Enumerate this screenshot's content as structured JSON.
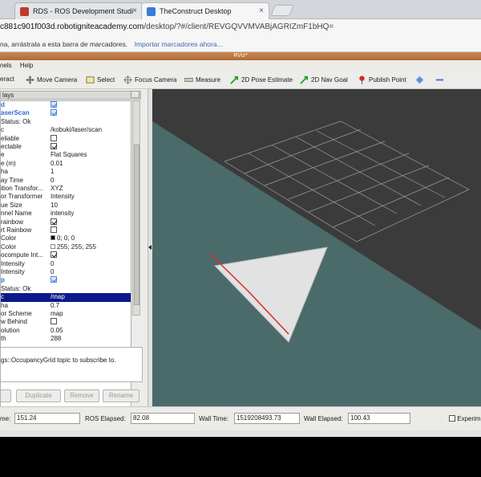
{
  "browser": {
    "tabs": [
      {
        "label": "RDS - ROS Development Studi",
        "active": false,
        "favicon_color": "#c0392b"
      },
      {
        "label": "TheConstruct Desktop",
        "active": true,
        "favicon_color": "#3a7bd5"
      }
    ],
    "url_host": "c881c901f003d.robotigniteacademy.com",
    "url_path": "/desktop/?#/client/REVGQVVMVABjAGRIZmF1bHQ=",
    "bookmarks_hint": "na, arrástrala a esta barra de marcadores.",
    "bookmarks_link": "Importar marcadores ahora..."
  },
  "rviz": {
    "title": "RViz*",
    "menu": [
      "nels",
      "Help"
    ],
    "toolbar": [
      "eract",
      "Move Camera",
      "Select",
      "Focus Camera",
      "Measure",
      "2D Pose Estimate",
      "2D Nav Goal",
      "Publish Point"
    ],
    "panel_title": "lays",
    "tree": [
      {
        "k": "d",
        "v": "",
        "cb": "blue-on",
        "style": "blue"
      },
      {
        "k": "aserScan",
        "v": "",
        "cb": "blue-on",
        "style": "blue"
      },
      {
        "k": "Status: Ok",
        "v": ""
      },
      {
        "k": "c",
        "v": "/kobuki/laser/scan"
      },
      {
        "k": "eliable",
        "v": "",
        "cb": "off"
      },
      {
        "k": "ectable",
        "v": "",
        "cb": "on"
      },
      {
        "k": "e",
        "v": "Flat Squares"
      },
      {
        "k": "e (m)",
        "v": "0.01"
      },
      {
        "k": "ha",
        "v": "1"
      },
      {
        "k": "ay Time",
        "v": "0"
      },
      {
        "k": "ition Transfor...",
        "v": "XYZ"
      },
      {
        "k": "or Transformer",
        "v": "Intensity"
      },
      {
        "k": "ue Size",
        "v": "10"
      },
      {
        "k": "nnel Name",
        "v": "intensity"
      },
      {
        "k": "rainbow",
        "v": "",
        "cb": "on"
      },
      {
        "k": "rt Rainbow",
        "v": "",
        "cb": "off"
      },
      {
        "k": "Color",
        "v": "0; 0; 0",
        "swatch": "#000000"
      },
      {
        "k": "Color",
        "v": "255; 255; 255",
        "swatch": "#ffffff"
      },
      {
        "k": "ocompute Int...",
        "v": "",
        "cb": "on"
      },
      {
        "k": "Intensity",
        "v": "0"
      },
      {
        "k": "Intensity",
        "v": "0"
      },
      {
        "k": "p",
        "v": "",
        "cb": "blue-on",
        "style": "blue"
      },
      {
        "k": "Status: Ok",
        "v": ""
      },
      {
        "k": "c",
        "v": "/map",
        "style": "hl"
      },
      {
        "k": "ha",
        "v": "0.7"
      },
      {
        "k": "or Scheme",
        "v": "map"
      },
      {
        "k": "w Behind",
        "v": "",
        "cb": "off"
      },
      {
        "k": "olution",
        "v": "0.05"
      },
      {
        "k": "th",
        "v": "288"
      }
    ],
    "description": "gs::OccupancyGrid topic to subscribe to.",
    "buttons": [
      "Duplicate",
      "Remove",
      "Rename"
    ],
    "time": {
      "ros_time_label": "me:",
      "ros_time": "151.24",
      "ros_elapsed_label": "ROS Elapsed:",
      "ros_elapsed": "82.08",
      "wall_time_label": "Wall Time:",
      "wall_time": "1519208493.73",
      "wall_elapsed_label": "Wall Elapsed:",
      "wall_elapsed": "100.43",
      "experimental_label": "Experim"
    }
  },
  "colors": {
    "grid_floor": "#4a6b6a",
    "grid_dark": "#3b3b3b",
    "map_fill": "#e2e2e2",
    "laser": "#d92a2a",
    "selection": "#0a1a8c"
  }
}
